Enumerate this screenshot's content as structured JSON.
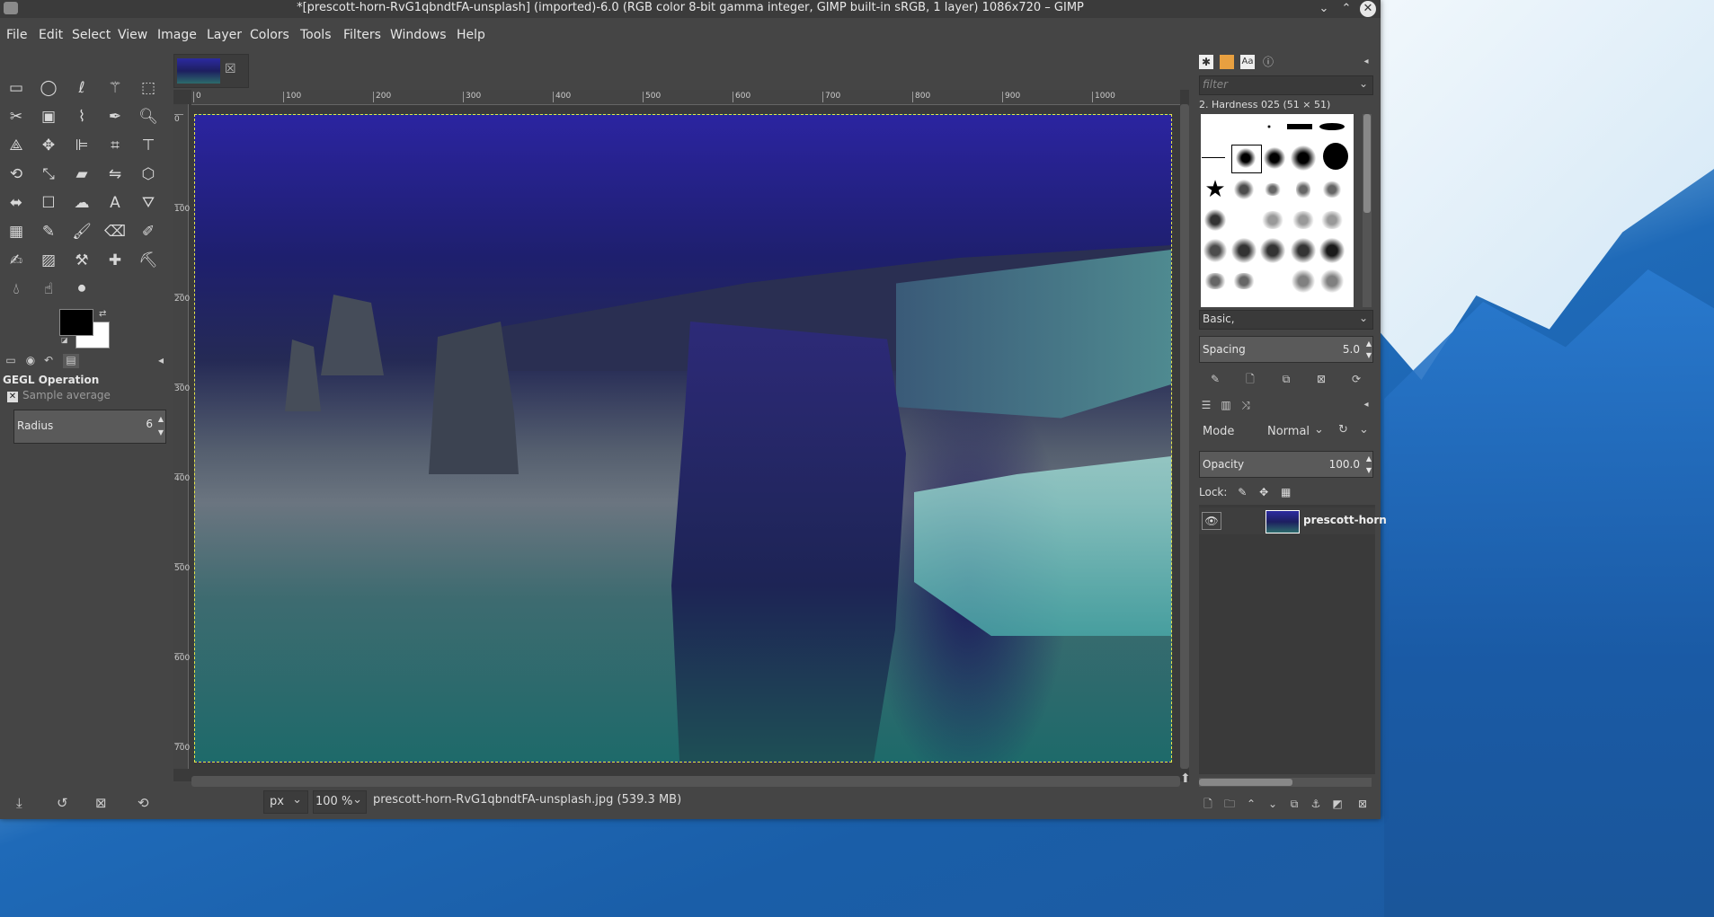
{
  "window": {
    "title": "*[prescott-horn-RvG1qbndtFA-unsplash] (imported)-6.0 (RGB color 8-bit gamma integer, GIMP built-in sRGB, 1 layer) 1086x720 – GIMP",
    "minimize": "⌄",
    "maximize": "⌃",
    "close": "✕"
  },
  "menu": [
    "File",
    "Edit",
    "Select",
    "View",
    "Image",
    "Layer",
    "Colors",
    "Tools",
    "Filters",
    "Windows",
    "Help"
  ],
  "gegl": {
    "title": "GEGL Operation",
    "subtitle": "Sample average",
    "radius_label": "Radius",
    "radius_value": "6"
  },
  "rulers": {
    "h_ticks": [
      "0",
      "100",
      "200",
      "300",
      "400",
      "500",
      "600",
      "700",
      "800",
      "900",
      "1000"
    ],
    "v_ticks": [
      "0",
      "100",
      "200",
      "300",
      "400",
      "500",
      "600",
      "700"
    ]
  },
  "status": {
    "unit": "px",
    "zoom": "100 %",
    "file_info": "prescott-horn-RvG1qbndtFA-unsplash.jpg (539.3 MB)"
  },
  "brushes": {
    "filter_placeholder": "filter",
    "selected_brush": "2. Hardness 025 (51 × 51)",
    "preset": "Basic,",
    "spacing_label": "Spacing",
    "spacing_value": "5.0"
  },
  "layers": {
    "mode_label": "Mode",
    "mode_value": "Normal",
    "opacity_label": "Opacity",
    "opacity_value": "100.0",
    "lock_label": "Lock:",
    "items": [
      {
        "name": "prescott-horn"
      }
    ]
  },
  "colors": {
    "fg": "#000000",
    "bg": "#ffffff",
    "selection_outline": "#e6e64a"
  }
}
